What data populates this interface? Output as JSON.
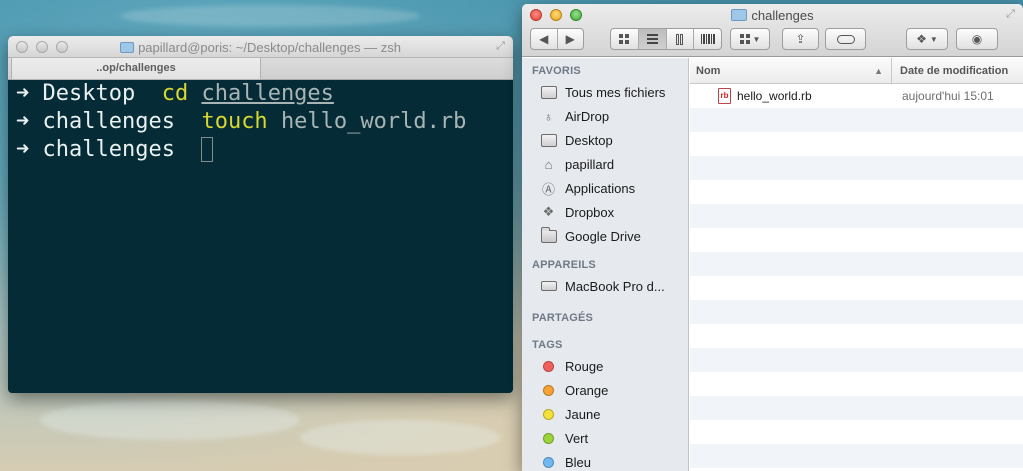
{
  "terminal": {
    "title": "papillard@poris: ~/Desktop/challenges — zsh",
    "tab_label": "..op/challenges",
    "lines": [
      {
        "arrow": "➜",
        "dir": "Desktop",
        "cmd": "cd",
        "arg": "challenges"
      },
      {
        "arrow": "➜",
        "dir": "challenges",
        "cmd": "touch",
        "arg": "hello_world.rb"
      },
      {
        "arrow": "➜",
        "dir": "challenges"
      }
    ]
  },
  "finder": {
    "title": "challenges",
    "sidebar": {
      "favorites_heading": "FAVORIS",
      "favorites": [
        {
          "label": "Tous mes fichiers",
          "icon": "all-files-icon"
        },
        {
          "label": "AirDrop",
          "icon": "airdrop-icon"
        },
        {
          "label": "Desktop",
          "icon": "desktop-icon"
        },
        {
          "label": "papillard",
          "icon": "home-icon"
        },
        {
          "label": "Applications",
          "icon": "applications-icon"
        },
        {
          "label": "Dropbox",
          "icon": "dropbox-icon"
        },
        {
          "label": "Google Drive",
          "icon": "folder-icon"
        }
      ],
      "devices_heading": "APPAREILS",
      "devices": [
        {
          "label": "MacBook Pro d...",
          "icon": "laptop-icon"
        }
      ],
      "shared_heading": "PARTAGÉS",
      "tags_heading": "TAGS",
      "tags": [
        {
          "label": "Rouge",
          "color": "#f25f5c"
        },
        {
          "label": "Orange",
          "color": "#f7a233"
        },
        {
          "label": "Jaune",
          "color": "#f4e13a"
        },
        {
          "label": "Vert",
          "color": "#9ad33a"
        },
        {
          "label": "Bleu",
          "color": "#6fb8f2"
        }
      ]
    },
    "columns": {
      "name": "Nom",
      "date": "Date de modification"
    },
    "files": [
      {
        "name": "hello_world.rb",
        "date": "aujourd'hui 15:01",
        "icon_text": "rb"
      }
    ]
  }
}
